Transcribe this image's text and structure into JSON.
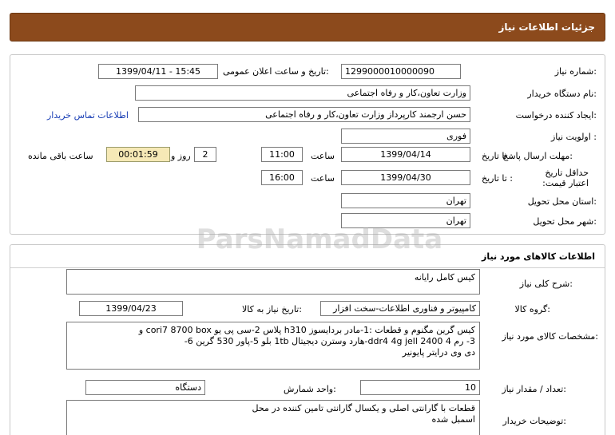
{
  "page": {
    "title": "جزئیات اطلاعات نیاز"
  },
  "need_info": {
    "need_number_label": "شماره نیاز:",
    "need_number": "1299000010000090",
    "announce_label": "تاریخ و ساعت اعلان عمومی:",
    "announce_value": "1399/04/11 - 15:45",
    "buyer_org_label": "نام دستگاه خریدار:",
    "buyer_org": "وزارت تعاون،کار و رفاه اجتماعی",
    "requester_label": "ایجاد کننده درخواست:",
    "requester": "حسن ارجمند کارپرداز وزارت تعاون،کار و رفاه اجتماعی",
    "contact_link": "اطلاعات تماس خریدار",
    "priority_label": "اولویت نیاز :",
    "priority": "فوری",
    "reply_deadline_label": "مهلت ارسال پاسخ:",
    "until_date_label": "تا تاریخ :",
    "reply_date": "1399/04/14",
    "time_label": "ساعت",
    "reply_time": "11:00",
    "days_value": "2",
    "days_label": "روز و",
    "remaining_time": "00:01:59",
    "remaining_label": "ساعت باقی مانده",
    "validity_label": "حداقل تاریخ اعتبار قیمت:",
    "validity_date": "1399/04/30",
    "validity_time": "16:00",
    "province_label": "استان محل تحویل:",
    "province": "تهران",
    "city_label": "شهر محل تحویل:",
    "city": "تهران"
  },
  "goods": {
    "section_title": "اطلاعات کالاهای مورد نیاز",
    "summary_label": "شرح کلی نیاز:",
    "summary": "کیس کامل رایانه",
    "group_label": "گروه کالا:",
    "group": "کامپیوتر و فناوری اطلاعات-سخت افزار",
    "need_date_label": "تاریخ نیاز به کالا:",
    "need_date": "1399/04/23",
    "spec_label": "مشخصات کالای مورد نیاز:",
    "spec_lines": [
      "کیس گرین مگنوم و قطعات :1-مادر بردایسوز h310 پلاس       2-سی پی یو cori7 8700 box      و",
      "3- رم ddr4 4g jell 2400      4-هارد وسترن دیجیتال 1tb بلو              5-پاور 530 گرین     6-",
      "دی وی درایتر پایونیر"
    ],
    "qty_label": "تعداد / مقدار نیاز:",
    "qty": "10",
    "unit_label": "واحد شمارش:",
    "unit": "دستگاه",
    "buyer_notes_label": "توضیحات خریدار:",
    "buyer_notes_lines": [
      "قطعات با گارانتی اصلی و یکسال گارانتی تامین کننده در محل",
      "اسمبل شده"
    ]
  },
  "watermark": {
    "text": "ParsNamadData"
  },
  "colors": {
    "header_bg": "#8c4a1c",
    "timer_bg": "#f6e9b6",
    "link": "#1a3fb5"
  }
}
